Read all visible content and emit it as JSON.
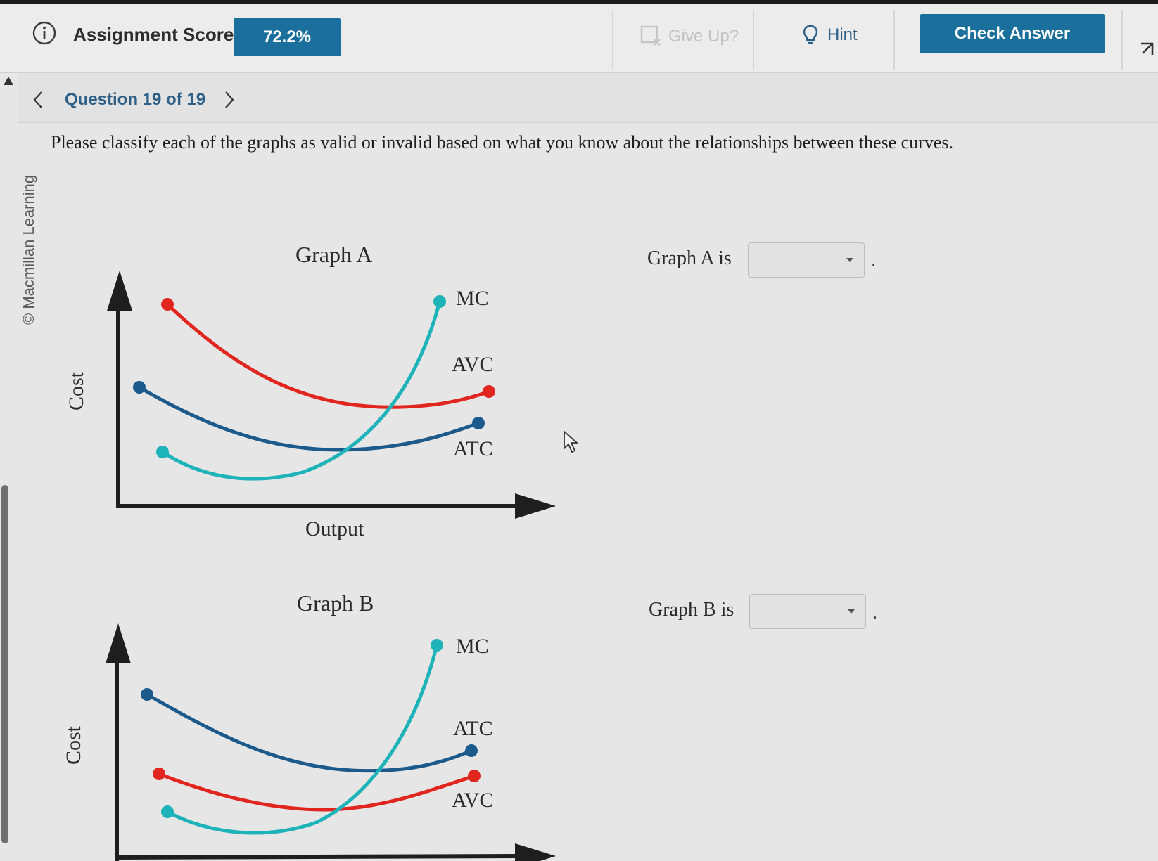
{
  "header": {
    "score_label": "Assignment Score:",
    "score_value": "72.2%",
    "give_up_label": "Give Up?",
    "hint_label": "Hint",
    "check_answer_label": "Check Answer"
  },
  "question_nav": {
    "label": "Question 19 of 19"
  },
  "watermark": "© Macmillan Learning",
  "prompt": "Please classify each of the graphs as valid or invalid based on what you know about the relationships between these curves.",
  "graphs": [
    {
      "title": "Graph A",
      "ylabel": "Cost",
      "xlabel": "Output",
      "curve_labels": [
        "MC",
        "AVC",
        "ATC"
      ],
      "answer_label": "Graph A is",
      "answer_value": ""
    },
    {
      "title": "Graph B",
      "ylabel": "Cost",
      "xlabel": "",
      "curve_labels": [
        "MC",
        "ATC",
        "AVC"
      ],
      "answer_label": "Graph B is",
      "answer_value": ""
    }
  ],
  "colors": {
    "brand": "#1a6f9c",
    "mc": "#1eb3b8",
    "avc": "#e0261e",
    "atc": "#1d5a8c",
    "link": "#2e5f86"
  },
  "icons": {
    "info": "info-circle-icon",
    "give_up": "give-up-icon",
    "hint": "lightbulb-icon",
    "prev": "chevron-left-icon",
    "next": "chevron-right-icon",
    "dropdown": "caret-down-icon"
  }
}
